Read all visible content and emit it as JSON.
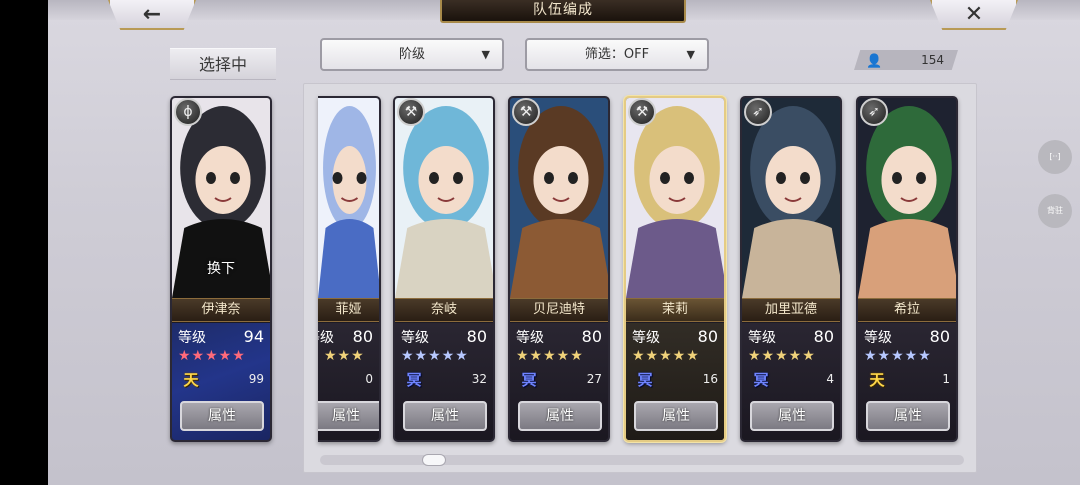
{
  "header": {
    "title": "队伍编成",
    "back_icon": "←",
    "close_icon": "✕"
  },
  "selected_label": "选择中",
  "filters": {
    "rank_dropdown": "阶级",
    "filter_dropdown": "筛选：OFF",
    "arrow": "▼"
  },
  "unit_count": "154",
  "side_buttons": {
    "b1": "[··]",
    "b2": "背驻"
  },
  "swap_text": "换下",
  "level_label": "等级",
  "attr_label": "属性",
  "colors": {
    "highlight_border": "#e4cb84",
    "heaven_rank": "#ffd84a",
    "underworld_rank": "#6f84ff",
    "star_red": "#ff6a7a",
    "star_gold": "#f0d27a",
    "star_blue": "#b7c8ff"
  },
  "selected_card": {
    "name": "伊津奈",
    "level": "94",
    "rank": "天",
    "rank_type": "heaven",
    "rank_num": "99",
    "star_color": "red",
    "stars": 5,
    "class_icon": "staff-class-icon",
    "class_glyph": "ϕ"
  },
  "cards": [
    {
      "name": "菲娅",
      "level": "80",
      "rank": "",
      "rank_type": "none",
      "rank_num": "0",
      "star_color": "gold",
      "stars": 3,
      "class_icon": "",
      "class_glyph": ""
    },
    {
      "name": "奈岐",
      "level": "80",
      "rank": "冥",
      "rank_type": "underworld",
      "rank_num": "32",
      "star_color": "blue",
      "stars": 5,
      "class_icon": "axe-class-icon",
      "class_glyph": "⚒"
    },
    {
      "name": "贝尼迪特",
      "level": "80",
      "rank": "冥",
      "rank_type": "underworld",
      "rank_num": "27",
      "star_color": "gold",
      "stars": 5,
      "class_icon": "axe-class-icon",
      "class_glyph": "⚒"
    },
    {
      "name": "茉莉",
      "level": "80",
      "rank": "冥",
      "rank_type": "underworld",
      "rank_num": "16",
      "star_color": "gold",
      "stars": 5,
      "class_icon": "axe-class-icon",
      "class_glyph": "⚒"
    },
    {
      "name": "加里亚德",
      "level": "80",
      "rank": "冥",
      "rank_type": "underworld",
      "rank_num": "4",
      "star_color": "gold",
      "stars": 5,
      "class_icon": "bow-class-icon",
      "class_glyph": "➶"
    },
    {
      "name": "希拉",
      "level": "80",
      "rank": "天",
      "rank_type": "heaven",
      "rank_num": "1",
      "star_color": "blue",
      "stars": 5,
      "class_icon": "bow-class-icon",
      "class_glyph": "➶"
    }
  ]
}
